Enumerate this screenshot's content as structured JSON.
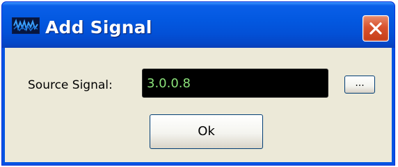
{
  "window": {
    "title": "Add Signal",
    "icon": "waveform-icon",
    "close_icon": "close-icon"
  },
  "form": {
    "source_label": "Source Signal:",
    "source_value": "3.0.0.8",
    "browse_label": "...",
    "ok_label": "Ok"
  },
  "colors": {
    "titlebar": "#0358e0",
    "client_bg": "#ece9d8",
    "field_bg": "#000000",
    "field_text": "#8be27a",
    "close_button": "#d8522e"
  }
}
